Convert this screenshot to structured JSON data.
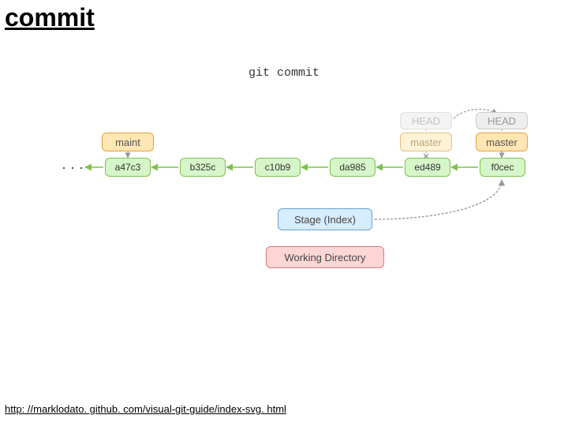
{
  "title": "commit",
  "command": "git commit",
  "heads": {
    "old": "HEAD",
    "new": "HEAD"
  },
  "branches": {
    "maint": "maint",
    "master_old": "master",
    "master_new": "master"
  },
  "commits": [
    "a47c3",
    "b325c",
    "c10b9",
    "da985",
    "ed489",
    "f0cec"
  ],
  "stage": "Stage (Index)",
  "wd": "Working Directory",
  "dots": "· · ·",
  "source": "http: //marklodato. github. com/visual-git-guide/index-svg. html",
  "colors": {
    "orange": "#ffe6b3",
    "green": "#d6f5c9",
    "blue": "#d6ecff",
    "red": "#ffd6d6",
    "arrow_green": "#7cc24a",
    "arrow_grey": "#999"
  }
}
